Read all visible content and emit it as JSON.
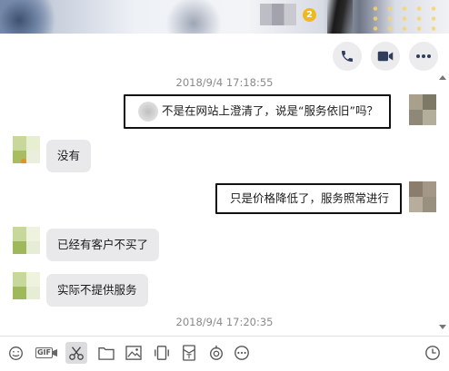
{
  "header": {
    "vip_badge": "2"
  },
  "actions": [
    {
      "icon": "phone-icon"
    },
    {
      "icon": "video-call-icon"
    },
    {
      "icon": "more-icon"
    }
  ],
  "messages": {
    "timestamp_1": "2018/9/4 17:18:55",
    "m1": "不是在网站上澄清了，说是“服务依旧”吗？",
    "m2": "没有",
    "m3": "只是价格降低了，服务照常进行",
    "m4": "已经有客户不买了",
    "m5": "实际不提供服务",
    "timestamp_2": "2018/9/4 17:20:35"
  },
  "toolbar": {
    "gif_label": "GIF",
    "items": [
      "emoji-icon",
      "gif-icon",
      "screenshot-scissors-icon",
      "folder-icon",
      "image-icon",
      "screen-capture-icon",
      "red-packet-icon",
      "voice-icon",
      "more-icon",
      "history-clock-icon"
    ]
  },
  "colors": {
    "incoming_bubble": "#e9e9eb",
    "outgoing_border": "#111111",
    "timestamp": "#8a8a8a",
    "icon": "#2f3d5a"
  }
}
